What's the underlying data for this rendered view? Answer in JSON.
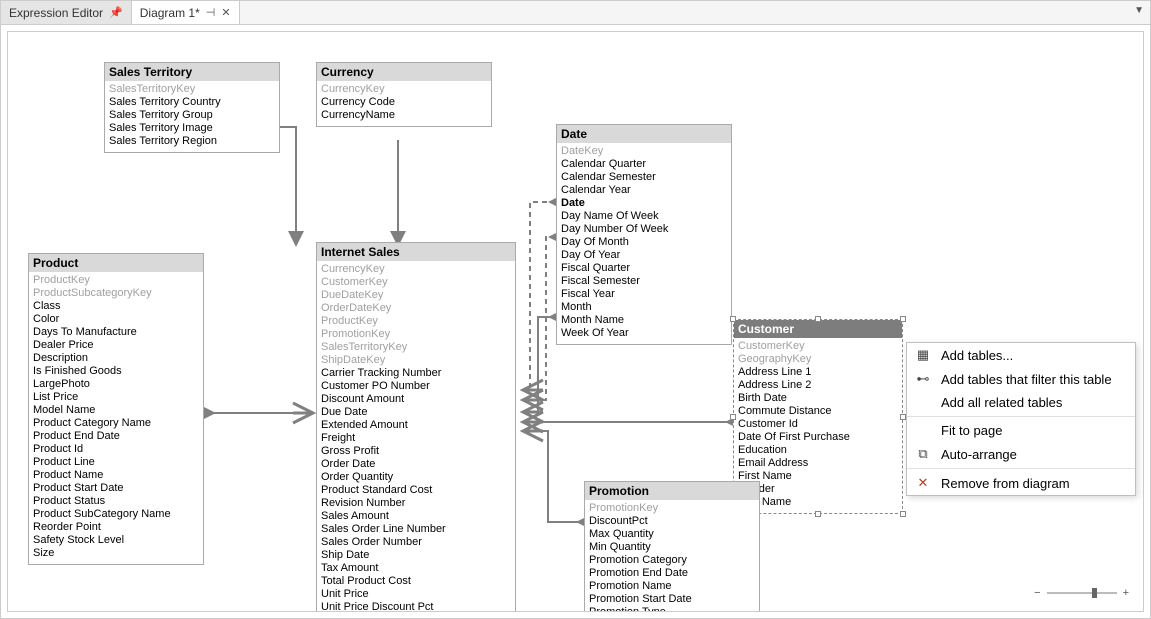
{
  "tabs": {
    "inactive": "Expression Editor",
    "active": "Diagram 1*"
  },
  "entities": {
    "salesTerritory": {
      "title": "Sales Territory",
      "fields": [
        {
          "t": "SalesTerritoryKey",
          "key": true
        },
        {
          "t": "Sales Territory Country"
        },
        {
          "t": "Sales Territory Group"
        },
        {
          "t": "Sales Territory Image"
        },
        {
          "t": "Sales Territory Region"
        }
      ]
    },
    "currency": {
      "title": "Currency",
      "fields": [
        {
          "t": "CurrencyKey",
          "key": true
        },
        {
          "t": "Currency Code"
        },
        {
          "t": "CurrencyName"
        }
      ]
    },
    "product": {
      "title": "Product",
      "fields": [
        {
          "t": "ProductKey",
          "key": true
        },
        {
          "t": "ProductSubcategoryKey",
          "key": true
        },
        {
          "t": "Class"
        },
        {
          "t": "Color"
        },
        {
          "t": "Days To Manufacture"
        },
        {
          "t": "Dealer Price"
        },
        {
          "t": "Description"
        },
        {
          "t": "Is Finished Goods"
        },
        {
          "t": "LargePhoto"
        },
        {
          "t": "List Price"
        },
        {
          "t": "Model Name"
        },
        {
          "t": "Product Category Name"
        },
        {
          "t": "Product End Date"
        },
        {
          "t": "Product Id"
        },
        {
          "t": "Product Line"
        },
        {
          "t": "Product Name"
        },
        {
          "t": "Product Start Date"
        },
        {
          "t": "Product Status"
        },
        {
          "t": "Product SubCategory Name"
        },
        {
          "t": "Reorder Point"
        },
        {
          "t": "Safety Stock Level"
        },
        {
          "t": "Size"
        }
      ]
    },
    "internetSales": {
      "title": "Internet Sales",
      "fields": [
        {
          "t": "CurrencyKey",
          "key": true
        },
        {
          "t": "CustomerKey",
          "key": true
        },
        {
          "t": "DueDateKey",
          "key": true
        },
        {
          "t": "OrderDateKey",
          "key": true
        },
        {
          "t": "ProductKey",
          "key": true
        },
        {
          "t": "PromotionKey",
          "key": true
        },
        {
          "t": "SalesTerritoryKey",
          "key": true
        },
        {
          "t": "ShipDateKey",
          "key": true
        },
        {
          "t": "Carrier Tracking Number"
        },
        {
          "t": "Customer PO Number"
        },
        {
          "t": "Discount Amount"
        },
        {
          "t": "Due Date"
        },
        {
          "t": "Extended Amount"
        },
        {
          "t": "Freight"
        },
        {
          "t": "Gross Profit"
        },
        {
          "t": "Order Date"
        },
        {
          "t": "Order Quantity"
        },
        {
          "t": "Product Standard Cost"
        },
        {
          "t": "Revision Number"
        },
        {
          "t": "Sales Amount"
        },
        {
          "t": "Sales Order Line Number"
        },
        {
          "t": "Sales Order Number"
        },
        {
          "t": "Ship Date"
        },
        {
          "t": "Tax Amount"
        },
        {
          "t": "Total Product Cost"
        },
        {
          "t": "Unit Price"
        },
        {
          "t": "Unit Price Discount Pct"
        }
      ]
    },
    "date": {
      "title": "Date",
      "fields": [
        {
          "t": "DateKey",
          "key": true
        },
        {
          "t": "Calendar Quarter"
        },
        {
          "t": "Calendar Semester"
        },
        {
          "t": "Calendar Year"
        },
        {
          "t": "Date",
          "bold": true
        },
        {
          "t": "Day Name Of Week"
        },
        {
          "t": "Day Number Of Week"
        },
        {
          "t": "Day Of Month"
        },
        {
          "t": "Day Of Year"
        },
        {
          "t": "Fiscal Quarter"
        },
        {
          "t": "Fiscal Semester"
        },
        {
          "t": "Fiscal Year"
        },
        {
          "t": "Month"
        },
        {
          "t": "Month Name"
        },
        {
          "t": "Week Of Year"
        }
      ]
    },
    "customer": {
      "title": "Customer",
      "fields": [
        {
          "t": "CustomerKey",
          "key": true
        },
        {
          "t": "GeographyKey",
          "key": true
        },
        {
          "t": "Address Line 1"
        },
        {
          "t": "Address Line 2"
        },
        {
          "t": "Birth Date"
        },
        {
          "t": "Commute Distance"
        },
        {
          "t": "Customer Id"
        },
        {
          "t": "Date Of First Purchase"
        },
        {
          "t": "Education"
        },
        {
          "t": "Email Address"
        },
        {
          "t": "First Name"
        },
        {
          "t": "Gender"
        },
        {
          "t": "Last Name"
        }
      ]
    },
    "promotion": {
      "title": "Promotion",
      "fields": [
        {
          "t": "PromotionKey",
          "key": true
        },
        {
          "t": "DiscountPct"
        },
        {
          "t": "Max Quantity"
        },
        {
          "t": "Min Quantity"
        },
        {
          "t": "Promotion Category"
        },
        {
          "t": "Promotion End Date"
        },
        {
          "t": "Promotion Name"
        },
        {
          "t": "Promotion Start Date"
        },
        {
          "t": "Promotion Type"
        }
      ]
    }
  },
  "contextMenu": {
    "items": [
      {
        "icon": "grid",
        "label": "Add tables..."
      },
      {
        "icon": "relation",
        "label": "Add tables that filter this table"
      },
      {
        "icon": "",
        "label": "Add all related tables"
      },
      {
        "icon": "",
        "label": "Fit to page"
      },
      {
        "icon": "arrange",
        "label": "Auto-arrange"
      },
      {
        "icon": "remove",
        "label": "Remove from diagram"
      }
    ]
  },
  "zoom": {
    "minus": "−",
    "plus": "+"
  }
}
